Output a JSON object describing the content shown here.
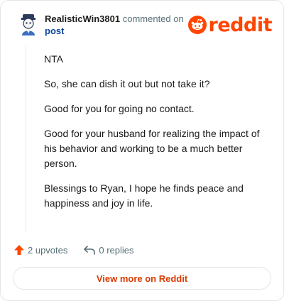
{
  "comment": {
    "username": "RealisticWin3801",
    "action_text": "commented on",
    "post_link": "post",
    "body": [
      "NTA",
      "So, she can dish it out but not take it?",
      "Good for you for going no contact.",
      "Good for your husband for realizing the impact of his behavior and working to be a much better person.",
      "Blessings to Ryan, I hope he finds peace and happiness and joy in life."
    ]
  },
  "brand": {
    "wordmark": "reddit",
    "icon": "reddit-alien-icon",
    "color": "#ff4500"
  },
  "actions": {
    "upvotes": "2 upvotes",
    "upvote_icon": "upvote-arrow-icon",
    "upvote_color": "#ff4500",
    "replies": "0 replies",
    "reply_icon": "reply-arrow-icon"
  },
  "footer": {
    "view_more": "View more on Reddit"
  }
}
